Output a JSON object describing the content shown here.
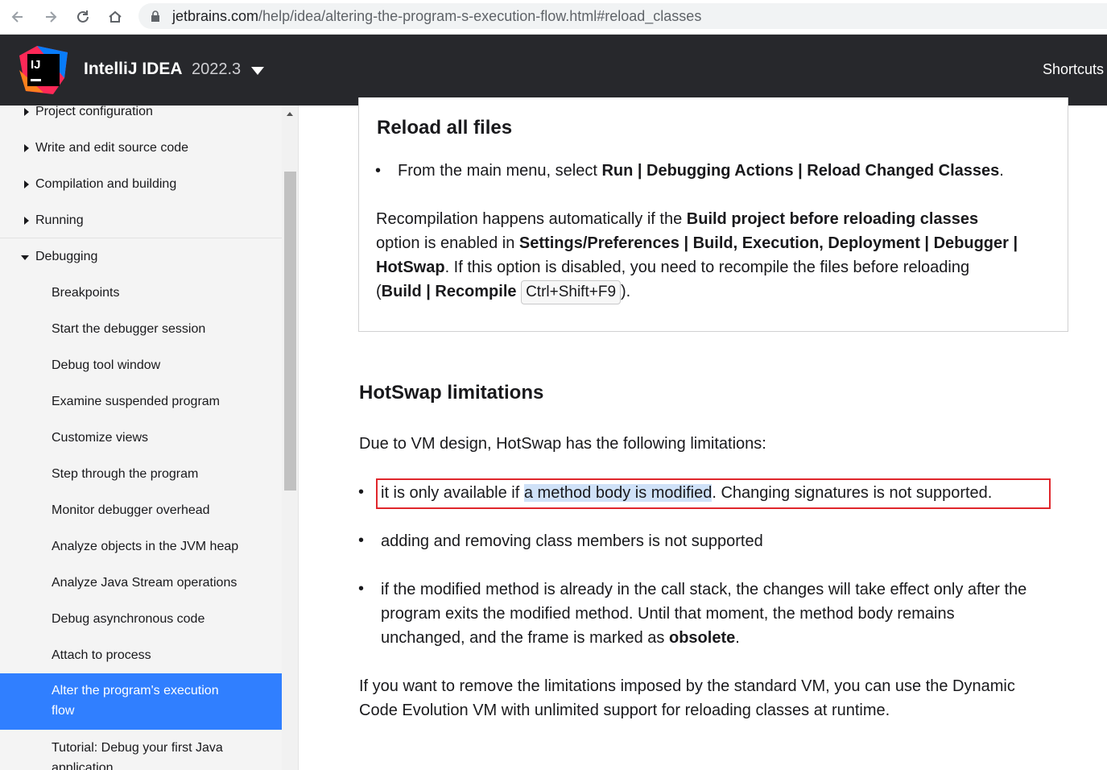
{
  "browser": {
    "url_host": "jetbrains.com",
    "url_path": "/help/idea/altering-the-program-s-execution-flow.html#reload_classes"
  },
  "header": {
    "product_name": "IntelliJ IDEA",
    "version": "2022.3",
    "shortcuts_label": "Shortcuts",
    "logo_text": "IJ"
  },
  "sidebar": {
    "items": [
      {
        "label": "Project configuration"
      },
      {
        "label": "Write and edit source code"
      },
      {
        "label": "Compilation and building"
      },
      {
        "label": "Running"
      },
      {
        "label": "Debugging"
      },
      {
        "label": "Breakpoints"
      },
      {
        "label": "Start the debugger session"
      },
      {
        "label": "Debug tool window"
      },
      {
        "label": "Examine suspended program"
      },
      {
        "label": "Customize views"
      },
      {
        "label": "Step through the program"
      },
      {
        "label": "Monitor debugger overhead"
      },
      {
        "label": "Analyze objects in the JVM heap"
      },
      {
        "label": "Analyze Java Stream operations"
      },
      {
        "label": "Debug asynchronous code"
      },
      {
        "label": "Attach to process"
      },
      {
        "label": "Alter the program's execution"
      },
      {
        "label": "flow"
      },
      {
        "label": "Tutorial: Debug your first Java"
      },
      {
        "label": "application"
      }
    ]
  },
  "tip": {
    "title": "Reload all files",
    "step_prefix": "From the main menu, select ",
    "step_menu": "Run | Debugging Actions | Reload Changed Classes",
    "step_suffix": ".",
    "p1": "Recompilation happens automatically if the ",
    "p1_b": "Build project before reloading classes",
    "p2": "option is enabled in ",
    "p2_b": "Settings/Preferences | Build, Execution, Deployment | Debugger |",
    "p3_b": "HotSwap",
    "p3": ". If this option is disabled, you need to recompile the files before reloading",
    "p4_open": "(",
    "p4_b": "Build | Recompile",
    "p4_kbd": "Ctrl+Shift+F9",
    "p4_close": ")."
  },
  "hotswap": {
    "title": "HotSwap limitations",
    "intro": "Due to VM design, HotSwap has the following limitations:",
    "l1_a": "it is only available if ",
    "l1_sel": "a method body is modified",
    "l1_b": ". Changing signatures is not supported.",
    "l2": "adding and removing class members is not supported",
    "l3_line1": "if the modified method is already in the call stack, the changes will take effect only after the",
    "l3_line2": "program exits the modified method. Until that moment, the method body remains",
    "l3_line3a": "unchanged, and the frame is marked as ",
    "l3_b": "obsolete",
    "l3_line3c": ".",
    "outro_line1": "If you want to remove the limitations imposed by the standard VM, you can use the Dynamic",
    "outro_line2": "Code Evolution VM with unlimited support for reloading classes at runtime."
  },
  "bullet_char": "•",
  "colors": {
    "header_bg": "#27282c",
    "sidebar_bg": "#f4f4f4",
    "active_item": "#307fff",
    "highlight_border": "#e0272c",
    "selection": "#cfe1f7"
  }
}
